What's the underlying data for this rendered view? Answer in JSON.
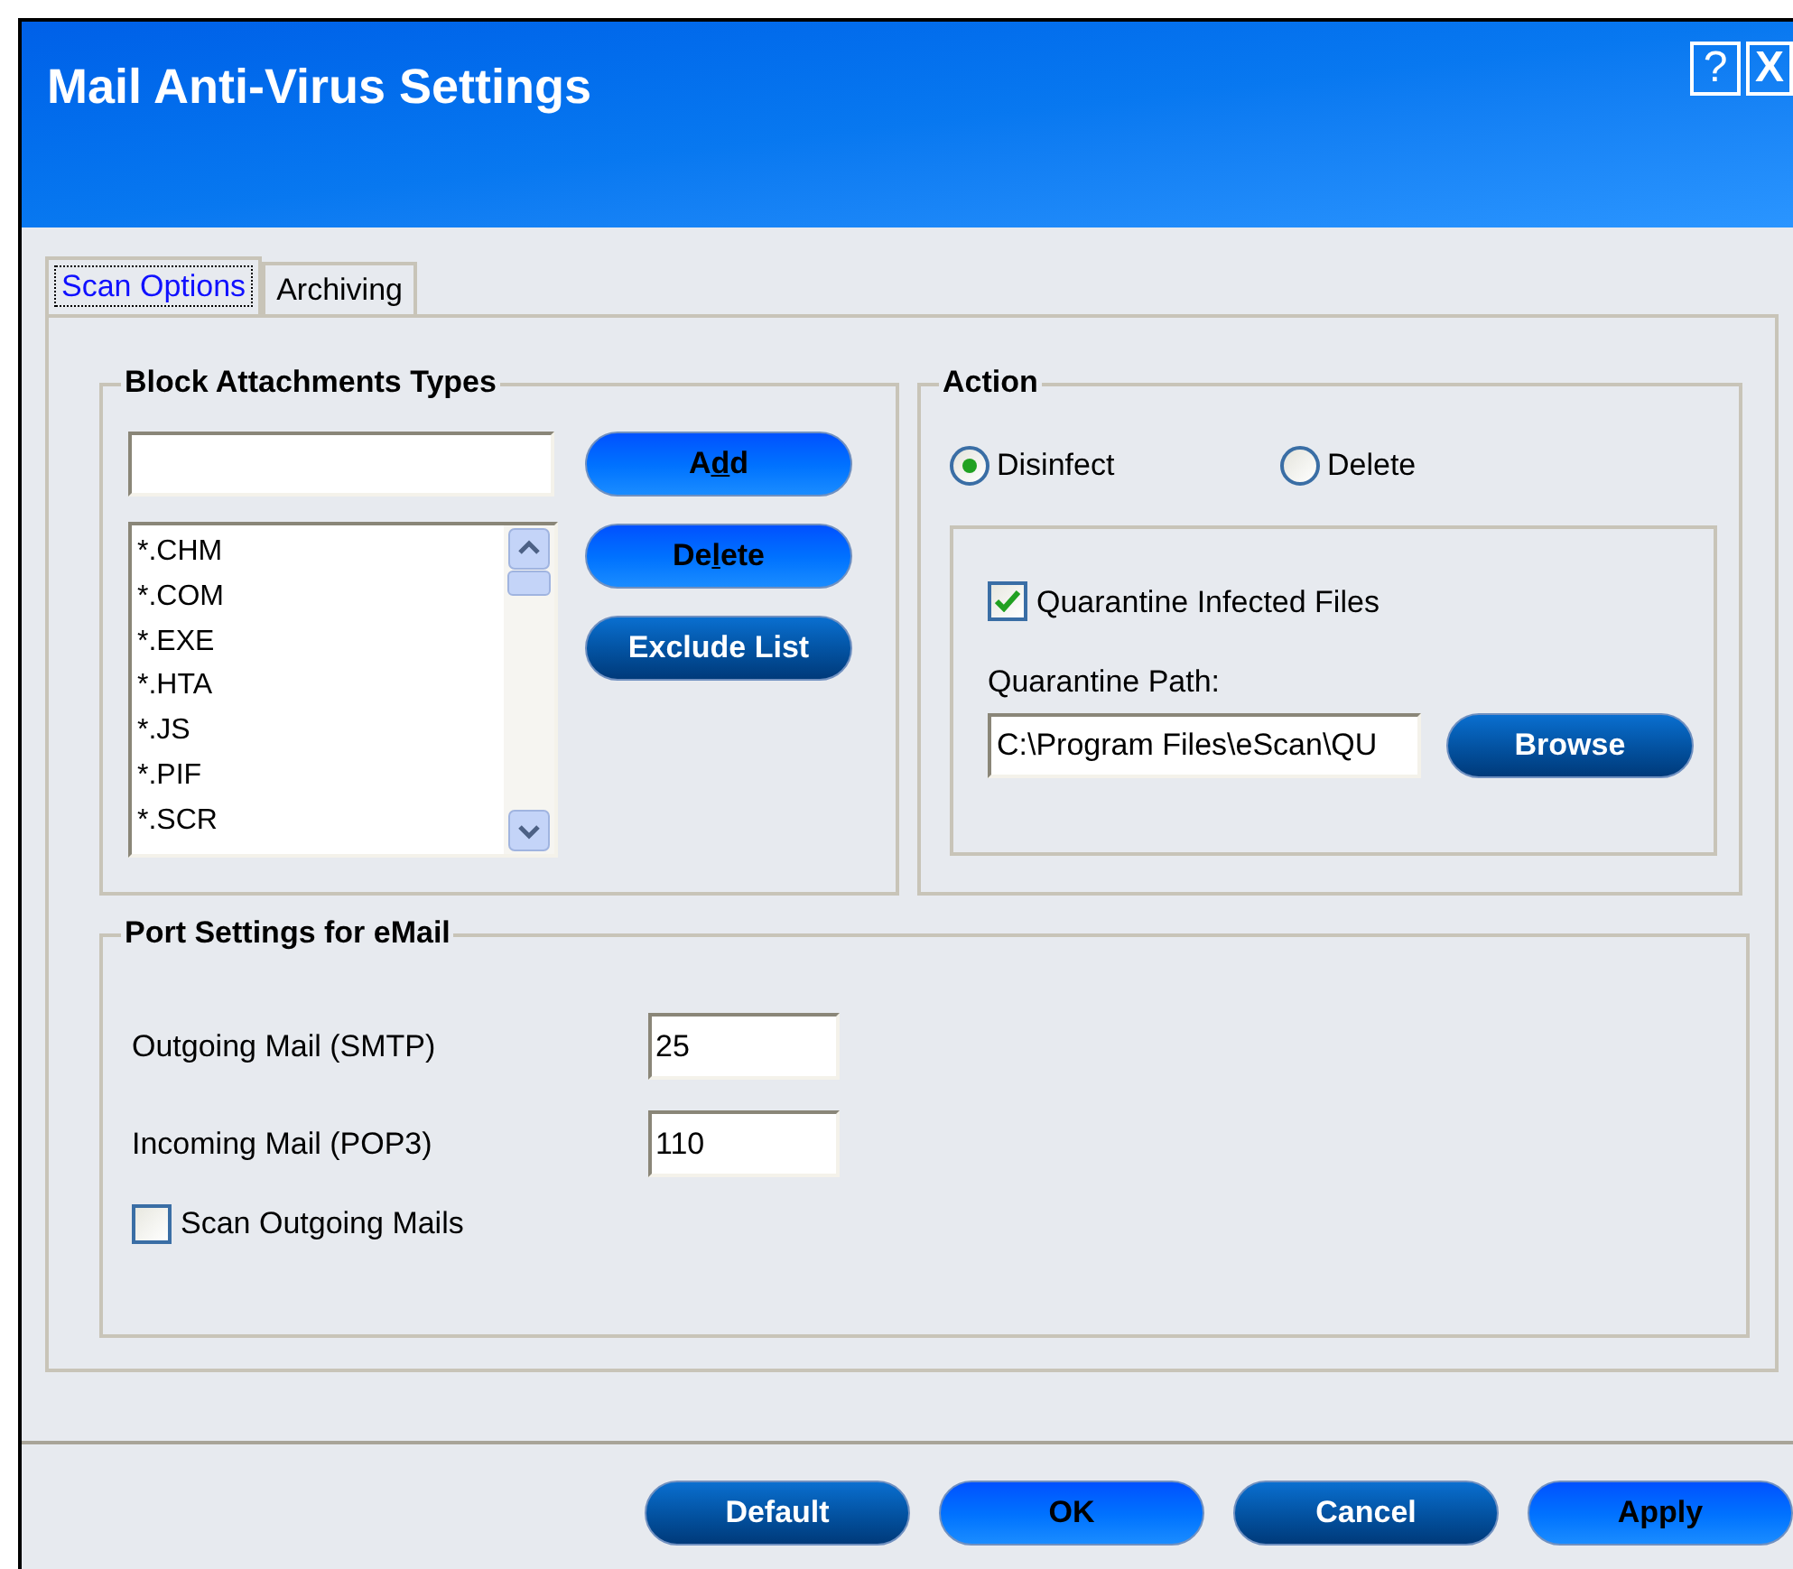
{
  "window": {
    "title": "Mail Anti-Virus Settings",
    "controls": [
      {
        "kind": "help",
        "label": "?"
      },
      {
        "kind": "close",
        "label": "X"
      }
    ]
  },
  "tabs": [
    {
      "label": "Scan Options",
      "selected": true
    },
    {
      "label": "Archiving",
      "selected": false
    }
  ],
  "block_attachments": {
    "title": "Block Attachments Types",
    "buttons": [
      {
        "label_before": "A",
        "hotkey": "d",
        "label_after": "d",
        "kind": "bright"
      },
      {
        "label_before": "De",
        "hotkey": "l",
        "label_after": "ete",
        "kind": "bright"
      },
      {
        "label_before": "Exclude List",
        "kind": "dark"
      }
    ],
    "items": [
      "*.CHM",
      "*.COM",
      "*.EXE",
      "*.HTA",
      "*.JS",
      "*.PIF",
      "*.SCR"
    ]
  },
  "action": {
    "title": "Action",
    "options": [
      {
        "label": "Disinfect",
        "selected": true
      },
      {
        "label": "Delete",
        "selected": false
      }
    ],
    "quarantine": {
      "label": "Quarantine Infected Files",
      "checked": true
    },
    "path_label": "Quarantine Path:",
    "path_value": "C:\\Program Files\\eScan\\QU",
    "browse": {
      "label_before": "Browse",
      "kind": "dark"
    }
  },
  "port_settings": {
    "title": "Port Settings for eMail",
    "fields": [
      {
        "label": "Outgoing Mail (SMTP)",
        "value": "25"
      },
      {
        "label": "Incoming Mail (POP3)",
        "value": "110"
      }
    ],
    "scan_outgoing": {
      "label": "Scan Outgoing Mails",
      "checked": false
    }
  },
  "footer_buttons": [
    {
      "label_before": "Default",
      "kind": "dark"
    },
    {
      "label_before": "OK",
      "kind": "bright"
    },
    {
      "label_before": "Cancel",
      "kind": "dark"
    },
    {
      "label_before": "Apply",
      "kind": "bright"
    }
  ]
}
